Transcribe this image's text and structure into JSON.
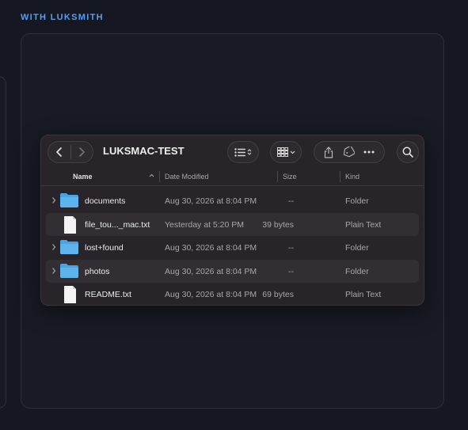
{
  "section_label": "WITH LUKSMITH",
  "finder": {
    "title": "LUKSMAC-TEST",
    "columns": {
      "name": "Name",
      "date": "Date Modified",
      "size": "Size",
      "kind": "Kind"
    },
    "rows": [
      {
        "name": "documents",
        "date": "Aug 30, 2026 at 8:04 PM",
        "size": "--",
        "kind": "Folder",
        "type": "folder",
        "expandable": true
      },
      {
        "name": "file_tou..._mac.txt",
        "date": "Yesterday at 5:20 PM",
        "size": "39 bytes",
        "kind": "Plain Text",
        "type": "file",
        "expandable": false
      },
      {
        "name": "lost+found",
        "date": "Aug 30, 2026 at 8:04 PM",
        "size": "--",
        "kind": "Folder",
        "type": "folder",
        "expandable": true
      },
      {
        "name": "photos",
        "date": "Aug 30, 2026 at 8:04 PM",
        "size": "--",
        "kind": "Folder",
        "type": "folder",
        "expandable": true
      },
      {
        "name": "README.txt",
        "date": "Aug 30, 2026 at 8:04 PM",
        "size": "69 bytes",
        "kind": "Plain Text",
        "type": "file",
        "expandable": false
      }
    ]
  },
  "colors": {
    "accent": "#5a9cf2",
    "folder": "#5eb3ec",
    "window_bg": "#282429",
    "page_bg": "#151820"
  },
  "icons": [
    "back-icon",
    "forward-icon",
    "list-view-icon",
    "grid-view-icon",
    "share-icon",
    "tag-icon",
    "more-icon",
    "search-icon",
    "folder-icon",
    "text-file-icon"
  ]
}
